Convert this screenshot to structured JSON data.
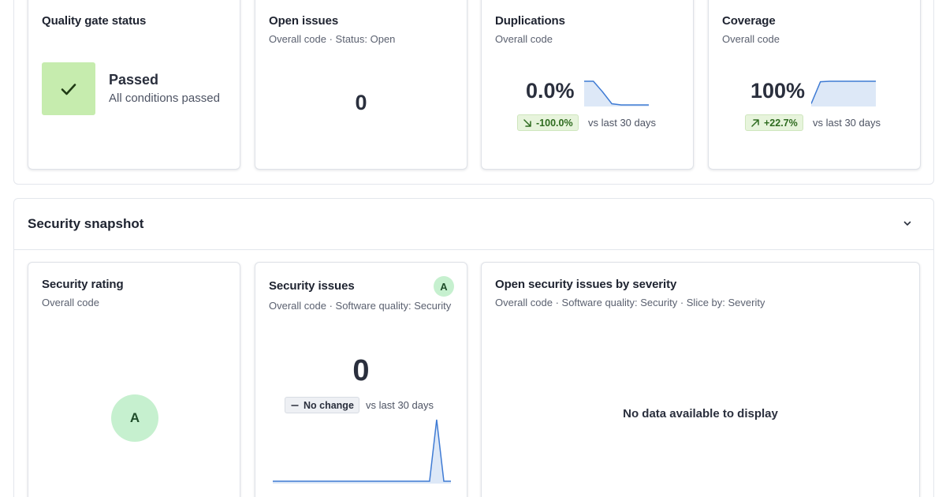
{
  "quality_gate": {
    "title": "Quality gate status",
    "status": "Passed",
    "description": "All conditions passed",
    "icon": "check-icon",
    "color": "#c6ecae"
  },
  "open_issues": {
    "title": "Open issues",
    "subtitle": "Overall code · Status: Open",
    "value": "0"
  },
  "duplications": {
    "title": "Duplications",
    "subtitle": "Overall code",
    "value": "0.0%",
    "trend": "-100.0%",
    "trend_icon": "arrow-down-right-icon",
    "vs_text": "vs last 30 days",
    "sparkline": [
      1,
      1,
      0.55,
      0.05,
      0,
      0,
      0,
      0
    ]
  },
  "coverage": {
    "title": "Coverage",
    "subtitle": "Overall code",
    "value": "100%",
    "trend": "+22.7%",
    "trend_icon": "arrow-up-right-icon",
    "vs_text": "vs last 30 days",
    "sparkline": [
      0.05,
      0.98,
      1,
      1,
      1,
      1,
      1,
      1
    ]
  },
  "security_snapshot": {
    "title": "Security snapshot",
    "collapse_icon": "chevron-down-icon"
  },
  "security_rating": {
    "title": "Security rating",
    "subtitle": "Overall code",
    "rating": "A",
    "color": "#c6f0cf"
  },
  "security_issues": {
    "title": "Security issues",
    "subtitle": "Overall code · Software quality: Security",
    "rating": "A",
    "value": "0",
    "trend": "No change",
    "trend_icon": "dash-icon",
    "vs_text": "vs last 30 days",
    "sparkline": [
      0,
      0,
      0,
      0,
      0,
      0,
      0,
      0,
      0,
      0,
      0,
      0,
      0,
      0,
      0,
      0,
      0,
      0,
      0,
      0,
      0,
      0,
      0,
      1,
      0,
      0
    ]
  },
  "severity": {
    "title": "Open security issues by severity",
    "subtitle": "Overall code · Software quality: Security · Slice by: Severity",
    "empty_message": "No data available to display"
  },
  "colors": {
    "accent": "#3f7bd4",
    "sparkline_fill": "#dde8f7",
    "success": "#c6ecae"
  }
}
